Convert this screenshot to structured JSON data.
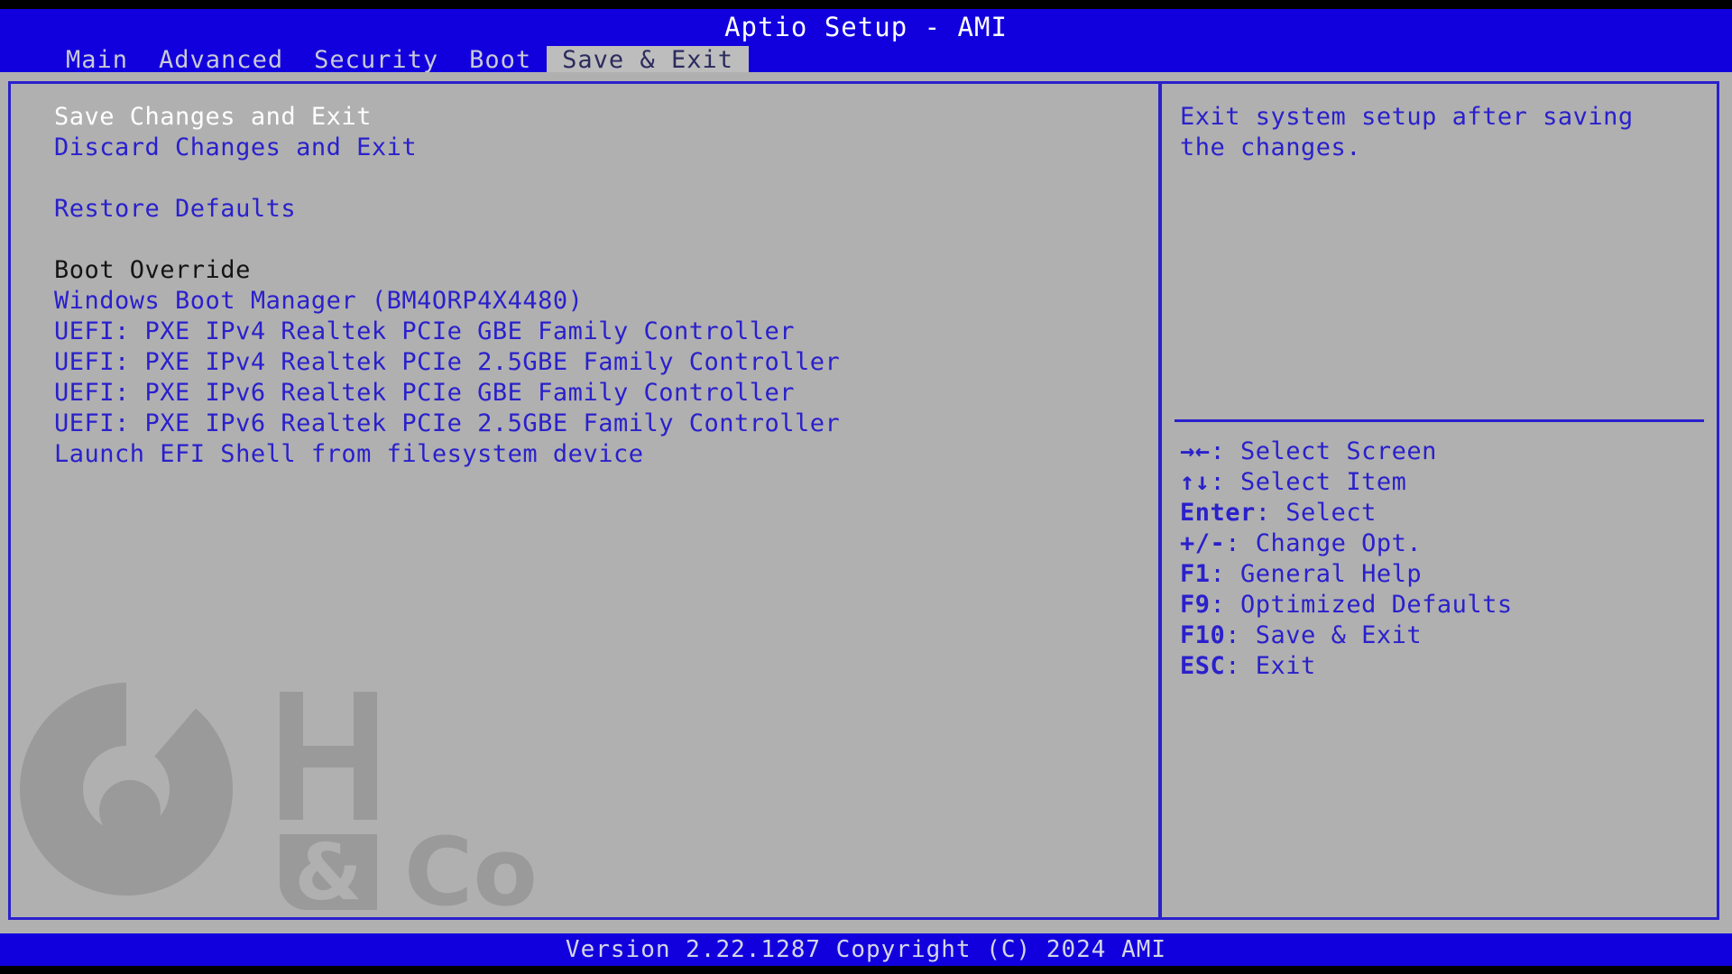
{
  "header": {
    "title": "Aptio Setup - AMI",
    "tabs": [
      {
        "label": "Main",
        "active": false
      },
      {
        "label": "Advanced",
        "active": false
      },
      {
        "label": "Security",
        "active": false
      },
      {
        "label": "Boot",
        "active": false
      },
      {
        "label": "Save & Exit",
        "active": true
      }
    ]
  },
  "menu": {
    "items": [
      {
        "label": "Save Changes and Exit",
        "style": "selected"
      },
      {
        "label": "Discard Changes and Exit",
        "style": "link"
      },
      {
        "label": " ",
        "style": "spacer"
      },
      {
        "label": "Restore Defaults",
        "style": "link"
      },
      {
        "label": " ",
        "style": "spacer"
      },
      {
        "label": "Boot Override",
        "style": "section"
      },
      {
        "label": "Windows Boot Manager (BM4ORP4X4480)",
        "style": "link"
      },
      {
        "label": "UEFI: PXE IPv4 Realtek PCIe GBE Family Controller",
        "style": "link"
      },
      {
        "label": "UEFI: PXE IPv4 Realtek PCIe 2.5GBE Family Controller",
        "style": "link"
      },
      {
        "label": "UEFI: PXE IPv6 Realtek PCIe GBE Family Controller",
        "style": "link"
      },
      {
        "label": "UEFI: PXE IPv6 Realtek PCIe 2.5GBE Family Controller",
        "style": "link"
      },
      {
        "label": "Launch EFI Shell from filesystem device",
        "style": "link"
      }
    ]
  },
  "help": {
    "lines": [
      "Exit system setup after saving",
      "the changes."
    ]
  },
  "legend": {
    "items": [
      {
        "keys": "→←",
        "text": ": Select Screen"
      },
      {
        "keys": "↑↓",
        "text": ": Select Item"
      },
      {
        "keys": "Enter",
        "text": ": Select"
      },
      {
        "keys": "+/-",
        "text": ": Change Opt."
      },
      {
        "keys": "F1",
        "text": ": General Help"
      },
      {
        "keys": "F9",
        "text": ": Optimized Defaults"
      },
      {
        "keys": "F10",
        "text": ": Save & Exit"
      },
      {
        "keys": "ESC",
        "text": ": Exit"
      }
    ]
  },
  "footer": {
    "version_text": "Version 2.22.1287 Copyright (C) 2024 AMI"
  },
  "watermark": {
    "letters": "H & Co"
  },
  "colors": {
    "header_blue": "#1100dd",
    "border_blue": "#2a20cc",
    "panel_gray": "#b0b0b0",
    "active_tab_gray": "#bdbdbd",
    "selected_white": "#ffffff",
    "section_black": "#141414"
  }
}
